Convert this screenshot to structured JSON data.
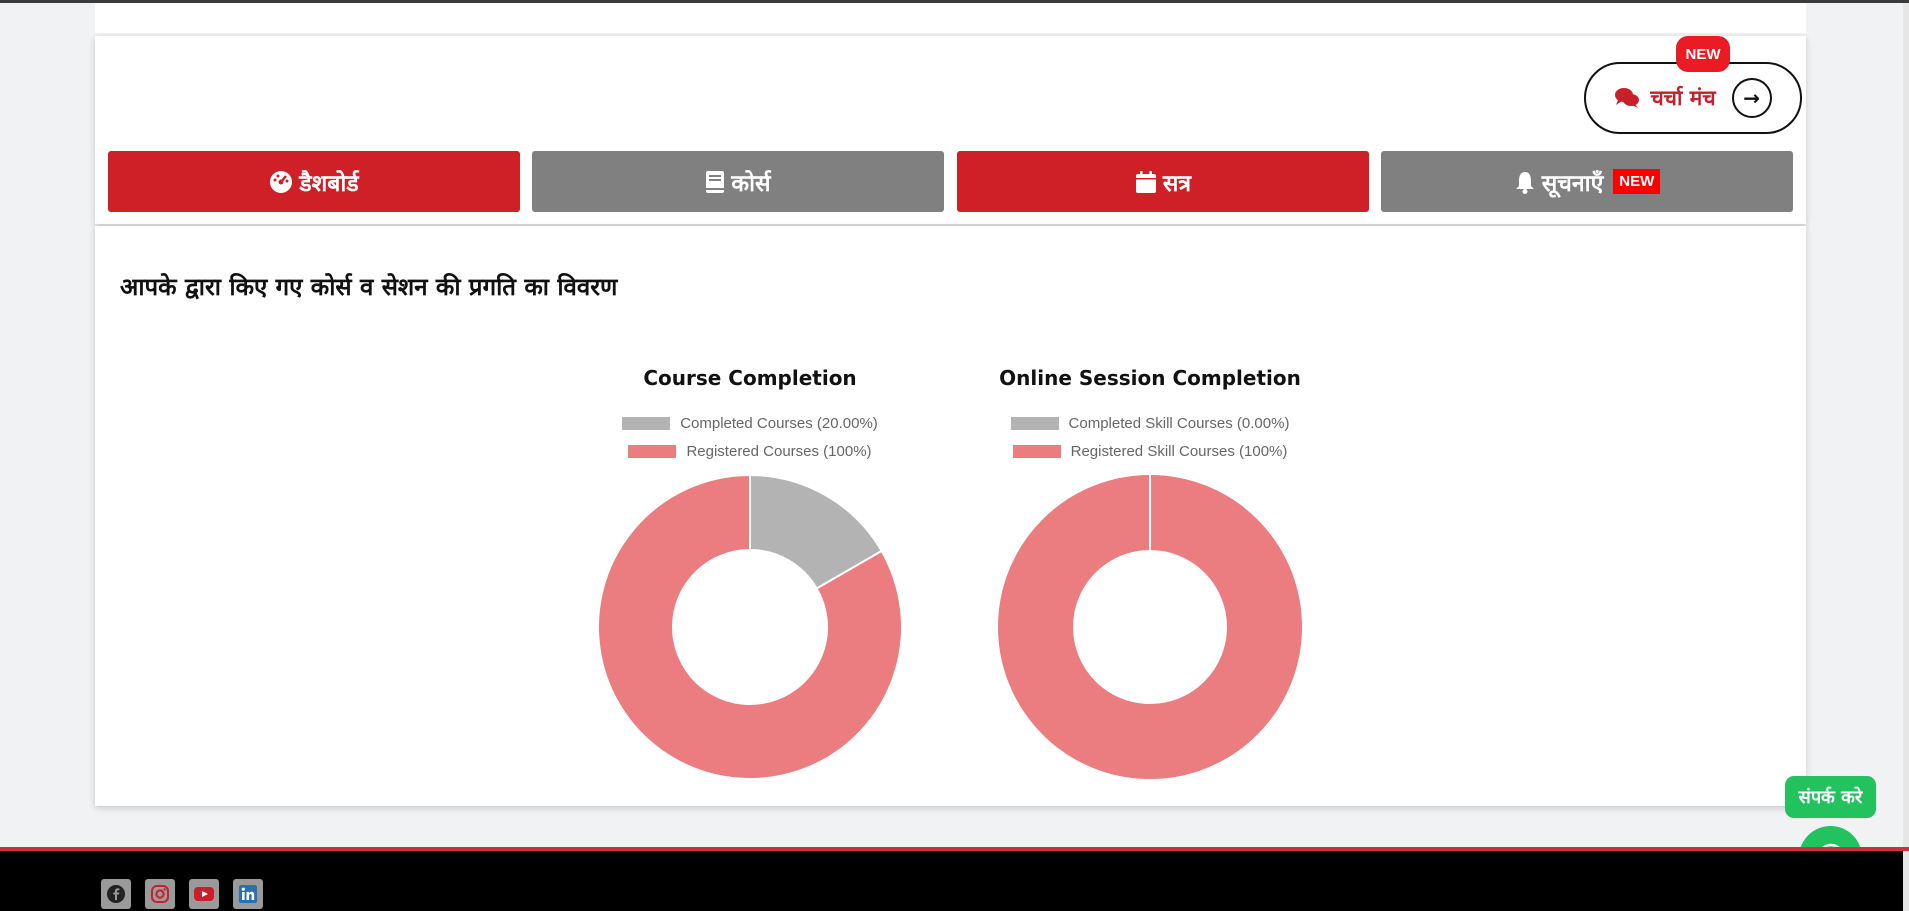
{
  "header": {
    "forum_label": "चर्चा मंच",
    "forum_new_badge": "NEW"
  },
  "tabs": [
    {
      "label": "डैशबोर्ड",
      "icon": "dashboard-icon",
      "color": "#cf2028"
    },
    {
      "label": "कोर्स",
      "icon": "book-icon",
      "color": "#808080"
    },
    {
      "label": "सत्र",
      "icon": "calendar-icon",
      "color": "#cf2028"
    },
    {
      "label": "सूचनाएँ",
      "icon": "bell-icon",
      "color": "#808080",
      "badge": "NEW"
    }
  ],
  "main": {
    "heading": "आपके द्वारा किए गए कोर्स व सेशन की प्रगति का विवरण"
  },
  "chart_data": [
    {
      "type": "pie",
      "title": "Course Completion",
      "legend": [
        "Completed Courses (20.00%)",
        "Registered Courses (100%)"
      ],
      "legend_position": "top",
      "labels": [
        "Completed Courses",
        "Registered Courses"
      ],
      "values": [
        20,
        100
      ],
      "colors": [
        "#b3b3b3",
        "#eb7c7f"
      ]
    },
    {
      "type": "pie",
      "title": "Online Session Completion",
      "legend": [
        "Completed Skill Courses (0.00%)",
        "Registered Skill Courses (100%)"
      ],
      "legend_position": "top",
      "labels": [
        "Completed Skill Courses",
        "Registered Skill Courses"
      ],
      "values": [
        0,
        100
      ],
      "colors": [
        "#b3b3b3",
        "#eb7c7f"
      ]
    }
  ],
  "floating": {
    "contact_label": "संपर्क करे",
    "whatsapp_icon": "whatsapp-icon"
  },
  "footer": {
    "social": [
      "facebook-icon",
      "instagram-icon",
      "youtube-icon",
      "linkedin-icon"
    ]
  },
  "colors": {
    "brand_red": "#cf2028",
    "tab_gray": "#808080",
    "badge_red": "#ea1b22",
    "whatsapp_green": "#22c35e"
  }
}
